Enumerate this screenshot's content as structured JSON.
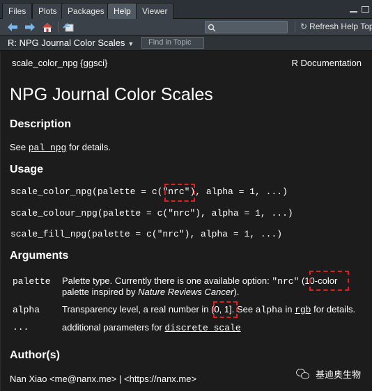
{
  "tabs": [
    {
      "label": "Files",
      "active": false
    },
    {
      "label": "Plots",
      "active": false
    },
    {
      "label": "Packages",
      "active": false
    },
    {
      "label": "Help",
      "active": true
    },
    {
      "label": "Viewer",
      "active": false
    }
  ],
  "toolbar": {
    "refresh_label": "Refresh Help Topic",
    "icons": [
      "back-arrow-icon",
      "forward-arrow-icon",
      "home-icon",
      "popout-icon",
      "search-icon",
      "refresh-icon"
    ]
  },
  "topic": {
    "title": "R: NPG Journal Color Scales",
    "find_placeholder": "Find in Topic"
  },
  "doc": {
    "header_left": "scale_color_npg {ggsci}",
    "header_right": "R Documentation",
    "title": "NPG Journal Color Scales",
    "description": {
      "heading": "Description",
      "pre": "See ",
      "link": "pal_npg",
      "post": " for details."
    },
    "usage": {
      "heading": "Usage",
      "lines": [
        "scale_color_npg(palette = c(\"nrc\"), alpha = 1, ...)",
        "scale_colour_npg(palette = c(\"nrc\"), alpha = 1, ...)",
        "scale_fill_npg(palette = c(\"nrc\"), alpha = 1, ...)"
      ]
    },
    "arguments": {
      "heading": "Arguments",
      "palette": {
        "name": "palette",
        "line1_pre": "Palette type. Currently there is one available option: ",
        "line1_code": "\"nrc\"",
        "line1_post": " (10-color",
        "line2_pre": "palette inspired by ",
        "line2_italic": "Nature Reviews Cancer",
        "line2_post": ")."
      },
      "alpha": {
        "name": "alpha",
        "pre": "Transparency level, a real number in ",
        "range": "(0, 1]",
        "mid": ". See ",
        "code": "alpha",
        "in": " in ",
        "link": "rgb",
        "post": " for details."
      },
      "dots": {
        "name": "...",
        "pre": "additional parameters for ",
        "link": "discrete_scale"
      }
    },
    "authors": {
      "heading": "Author(s)",
      "line": "Nan Xiao <me@nanx.me> | <https://nanx.me>"
    }
  },
  "watermark": {
    "text": "基迪奥生物"
  },
  "colors": {
    "highlight_box": "#e02020",
    "accent_icon": "#7fb4e6"
  }
}
